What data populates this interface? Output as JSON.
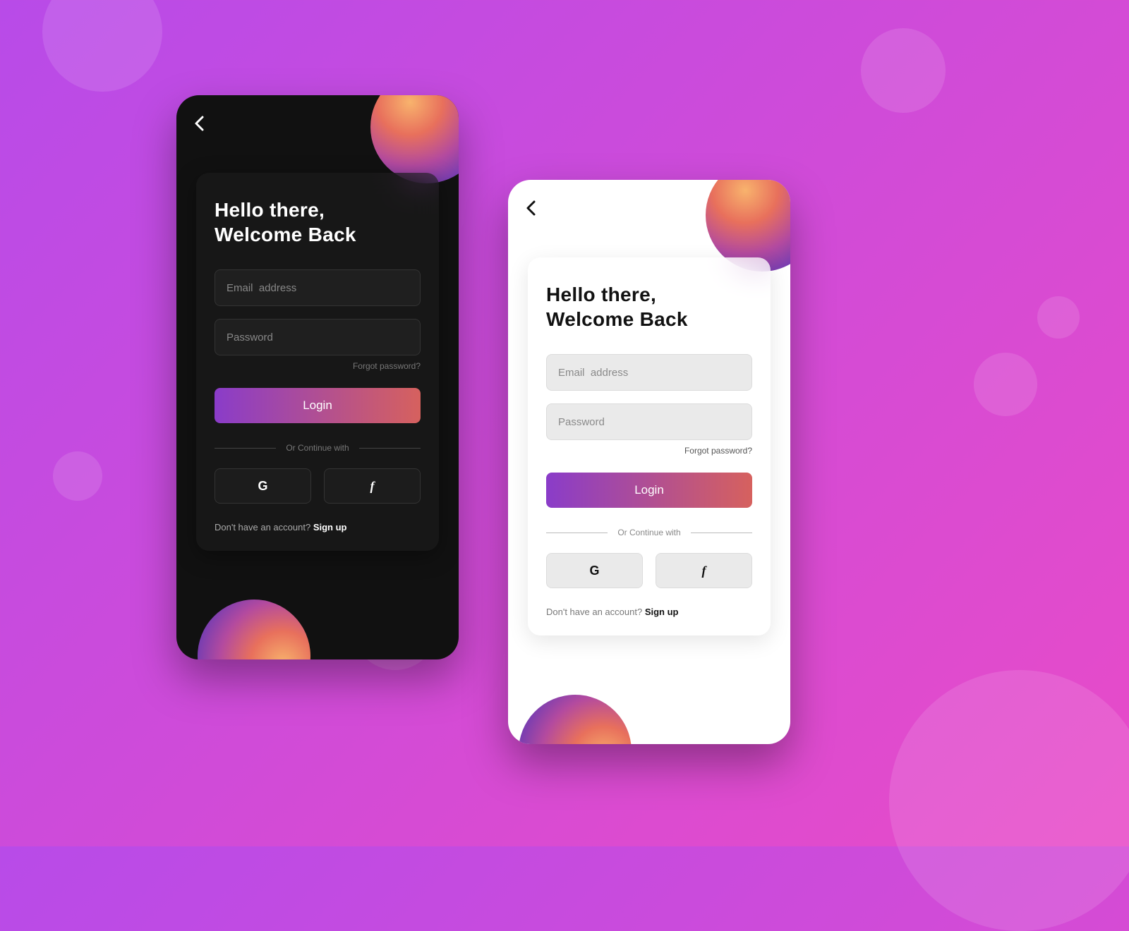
{
  "login": {
    "heading_line1": "Hello there,",
    "heading_line2": "Welcome Back",
    "email_placeholder": "Email  address",
    "password_placeholder": "Password",
    "forgot_label": "Forgot password?",
    "login_button": "Login",
    "divider_text": "Or Continue with",
    "social": {
      "google_label": "G",
      "facebook_label": "f"
    },
    "signup_prompt": "Don't have an account? ",
    "signup_action": "Sign up"
  },
  "colors": {
    "gradient_start": "#8a3cc9",
    "gradient_end": "#d6615e",
    "bg_start": "#b84be8",
    "bg_end": "#e84bc8"
  }
}
